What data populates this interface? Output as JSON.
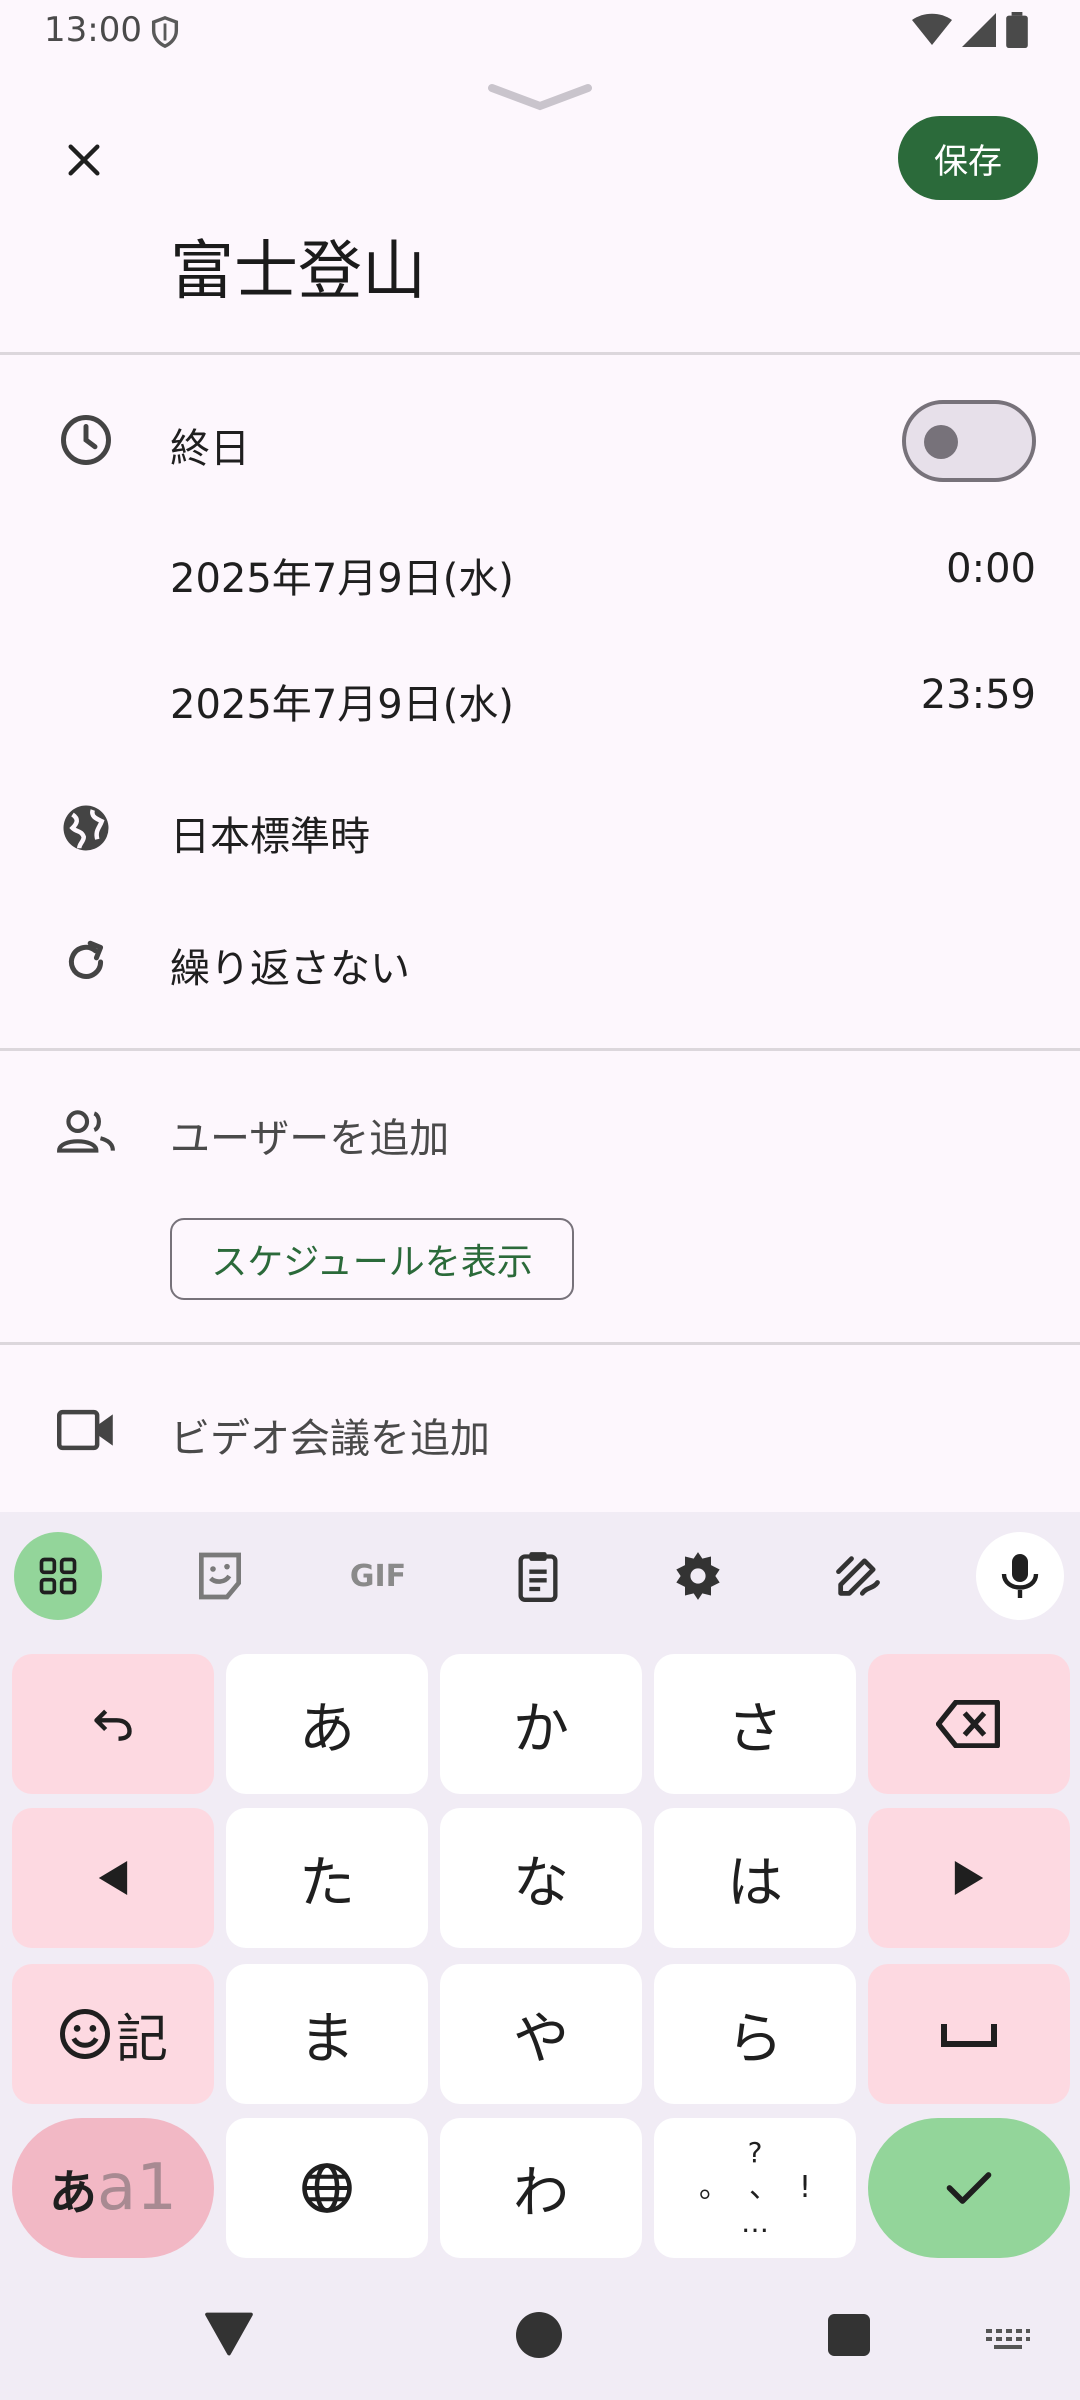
{
  "status_bar": {
    "time": "13:00"
  },
  "header": {
    "save_label": "保存",
    "title": "富士登山"
  },
  "event": {
    "all_day_label": "終日",
    "start_date": "2025年7月9日(水)",
    "start_time": "0:00",
    "end_date": "2025年7月9日(水)",
    "end_time": "23:59",
    "timezone": "日本標準時",
    "repeat": "繰り返さない",
    "add_users": "ユーザーを追加",
    "show_schedule": "スケジュールを表示",
    "add_video": "ビデオ会議を追加"
  },
  "keyboard": {
    "toolbar": {
      "gif": "GIF"
    },
    "rows": [
      [
        "あ",
        "か",
        "さ"
      ],
      [
        "た",
        "な",
        "は"
      ],
      [
        "ま",
        "や",
        "ら"
      ]
    ],
    "emoji_key_label": "記",
    "mode_key": {
      "main": "あ",
      "sub": "a1"
    },
    "wa_key": "わ",
    "punct_key": {
      "top": "?",
      "left": "。",
      "mid": "、",
      "right": "!",
      "bottom": "…"
    }
  },
  "colors": {
    "accent_green": "#2b6a3a",
    "pink_key": "#fdd9e1",
    "enter_green": "#93d59a"
  }
}
